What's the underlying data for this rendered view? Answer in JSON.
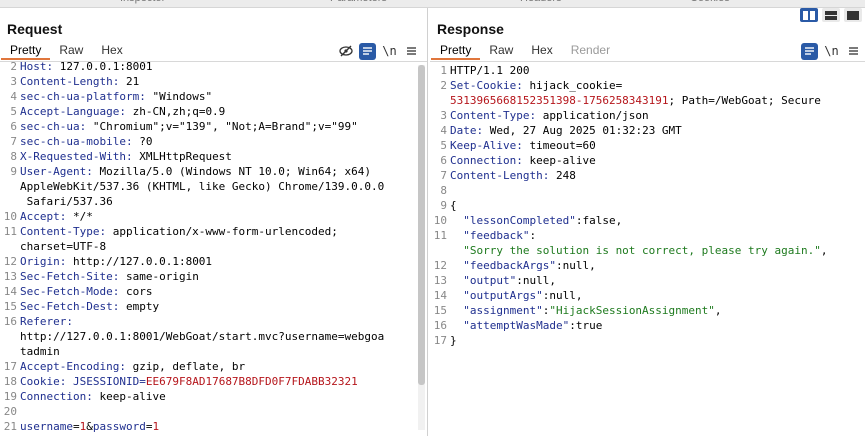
{
  "request": {
    "title": "Request",
    "tabs": [
      "Pretty",
      "Raw",
      "Hex"
    ],
    "lines": [
      {
        "n": "2",
        "k": "Host:",
        "v": " 127.0.0.1:8001"
      },
      {
        "n": "3",
        "k": "Content-Length:",
        "v": " 21"
      },
      {
        "n": "4",
        "k": "sec-ch-ua-platform:",
        "v": " \"Windows\""
      },
      {
        "n": "5",
        "k": "Accept-Language:",
        "v": " zh-CN,zh;q=0.9"
      },
      {
        "n": "6",
        "k": "sec-ch-ua:",
        "v": " \"Chromium\";v=\"139\", \"Not;A=Brand\";v=\"99\""
      },
      {
        "n": "7",
        "k": "sec-ch-ua-mobile:",
        "v": " ?0"
      },
      {
        "n": "8",
        "k": "X-Requested-With:",
        "v": " XMLHttpRequest"
      },
      {
        "n": "9",
        "k": "User-Agent:",
        "v": " Mozilla/5.0 (Windows NT 10.0; Win64; x64)"
      },
      {
        "n": "",
        "k": "",
        "v": "AppleWebKit/537.36 (KHTML, like Gecko) Chrome/139.0.0.0"
      },
      {
        "n": "",
        "k": "",
        "v": " Safari/537.36"
      },
      {
        "n": "10",
        "k": "Accept:",
        "v": " */*"
      },
      {
        "n": "11",
        "k": "Content-Type:",
        "v": " application/x-www-form-urlencoded;"
      },
      {
        "n": "",
        "k": "",
        "v": "charset=UTF-8"
      },
      {
        "n": "12",
        "k": "Origin:",
        "v": " http://127.0.0.1:8001"
      },
      {
        "n": "13",
        "k": "Sec-Fetch-Site:",
        "v": " same-origin"
      },
      {
        "n": "14",
        "k": "Sec-Fetch-Mode:",
        "v": " cors"
      },
      {
        "n": "15",
        "k": "Sec-Fetch-Dest:",
        "v": " empty"
      },
      {
        "n": "16",
        "k": "Referer:",
        "v": ""
      },
      {
        "n": "",
        "k": "",
        "v": "http://127.0.0.1:8001/WebGoat/start.mvc?username=webgoa"
      },
      {
        "n": "",
        "k": "",
        "v": "tadmin"
      },
      {
        "n": "17",
        "k": "Accept-Encoding:",
        "v": " gzip, deflate, br"
      },
      {
        "n": "18",
        "k": "Cookie:",
        "v": " ",
        "cookie_name": "JSESSIONID=",
        "cookie_val": "EE679F8AD17687B8DFD0F7FDABB32321"
      },
      {
        "n": "19",
        "k": "Connection:",
        "v": " keep-alive"
      },
      {
        "n": "20",
        "k": "",
        "v": ""
      },
      {
        "n": "21",
        "k": "",
        "v": "",
        "body": true
      }
    ],
    "body": {
      "k1": "username",
      "eq1": "=",
      "v1": "1",
      "amp": "&",
      "k2": "password",
      "eq2": "=",
      "v2": "1"
    }
  },
  "response": {
    "title": "Response",
    "tabs": [
      "Pretty",
      "Raw",
      "Hex",
      "Render"
    ],
    "lines": [
      {
        "n": "1",
        "k": "",
        "v": "HTTP/1.1 200"
      },
      {
        "n": "2",
        "k": "Set-Cookie:",
        "v": " hijack_cookie="
      },
      {
        "n": "",
        "k": "",
        "v": "",
        "red": "5313965668152351398-1756258343191",
        "rest": "; Path=/WebGoat; Secure"
      },
      {
        "n": "3",
        "k": "Content-Type:",
        "v": " application/json"
      },
      {
        "n": "4",
        "k": "Date:",
        "v": " Wed, 27 Aug 2025 01:32:23 GMT"
      },
      {
        "n": "5",
        "k": "Keep-Alive:",
        "v": " timeout=60"
      },
      {
        "n": "6",
        "k": "Connection:",
        "v": " keep-alive"
      },
      {
        "n": "7",
        "k": "Content-Length:",
        "v": " 248"
      },
      {
        "n": "8",
        "k": "",
        "v": ""
      },
      {
        "n": "9",
        "k": "",
        "v": "{"
      },
      {
        "n": "10",
        "k": "  \"lessonCompleted\"",
        "v": ":false,"
      },
      {
        "n": "11",
        "k": "  \"feedback\"",
        "v": ":"
      },
      {
        "n": "",
        "k": "",
        "v": "",
        "green": "  \"Sorry the solution is not correct, please try again.\"",
        "rest": ","
      },
      {
        "n": "12",
        "k": "  \"feedbackArgs\"",
        "v": ":null,"
      },
      {
        "n": "13",
        "k": "  \"output\"",
        "v": ":null,"
      },
      {
        "n": "14",
        "k": "  \"outputArgs\"",
        "v": ":null,"
      },
      {
        "n": "15",
        "k": "  \"assignment\"",
        "v": ":",
        "green": "\"HijackSessionAssignment\"",
        "rest": ","
      },
      {
        "n": "16",
        "k": "  \"attemptWasMade\"",
        "v": ":true"
      },
      {
        "n": "17",
        "k": "",
        "v": "}"
      }
    ]
  },
  "topstrip": [
    "Inspector",
    "Parameters",
    "Headers",
    "Cookies"
  ],
  "icons": {
    "hide": "eye-slash-icon",
    "wrap": "word-wrap-icon",
    "newline": "newline-icon",
    "menu": "hamburger-menu-icon"
  }
}
